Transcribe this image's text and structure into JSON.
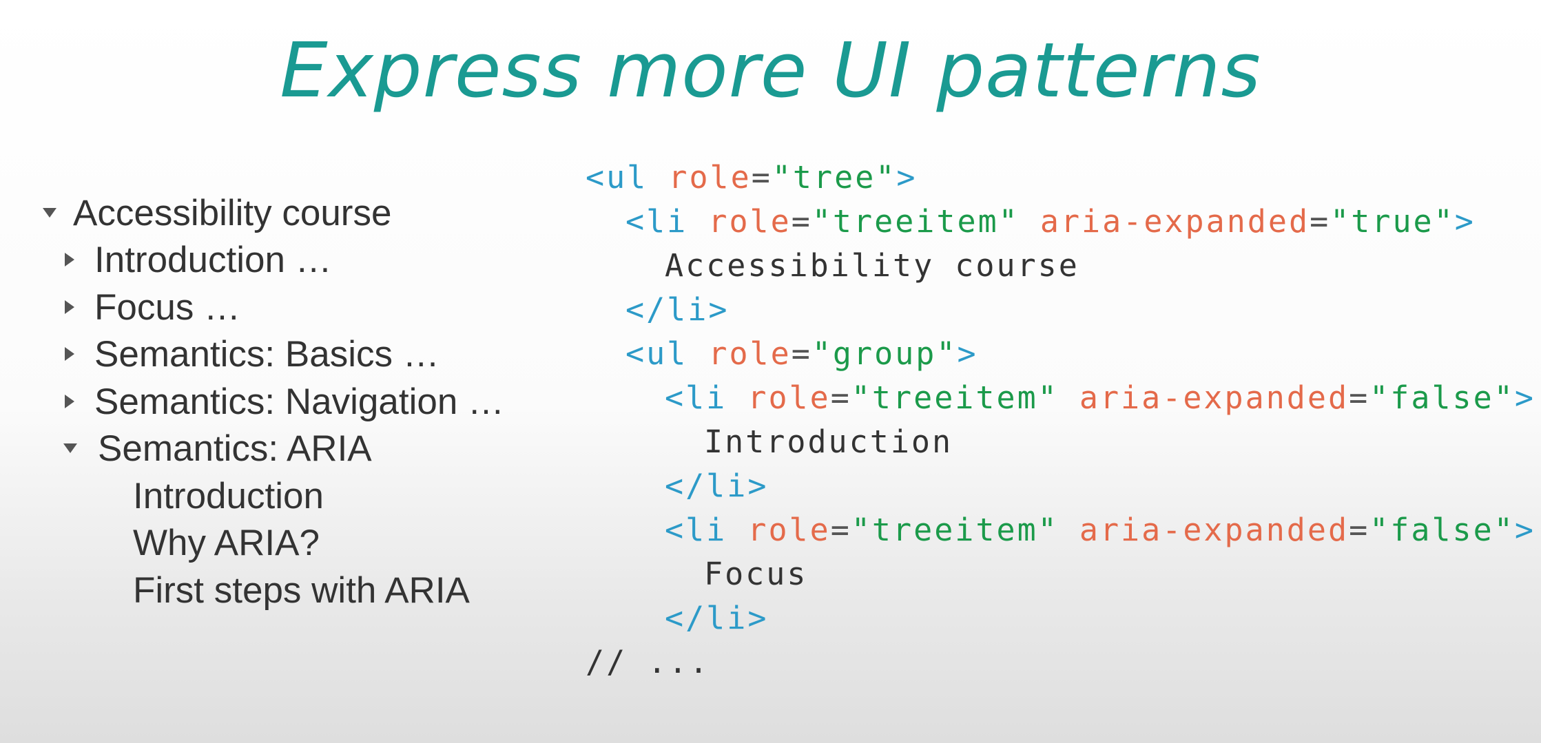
{
  "slide": {
    "title": "Express more UI patterns"
  },
  "tree": {
    "items": [
      {
        "label": "Accessibility course",
        "toggle": "expanded",
        "level": 0
      },
      {
        "label": "Introduction …",
        "toggle": "collapsed",
        "level": 1
      },
      {
        "label": "Focus …",
        "toggle": "collapsed",
        "level": 1
      },
      {
        "label": "Semantics: Basics …",
        "toggle": "collapsed",
        "level": 1
      },
      {
        "label": "Semantics: Navigation …",
        "toggle": "collapsed",
        "level": 1
      },
      {
        "label": "Semantics: ARIA",
        "toggle": "expanded",
        "level": 1
      },
      {
        "label": "Introduction",
        "toggle": "none",
        "level": 2
      },
      {
        "label": "Why ARIA?",
        "toggle": "none",
        "level": 2
      },
      {
        "label": "First steps with ARIA",
        "toggle": "none",
        "level": 2
      }
    ]
  },
  "code": {
    "line1": {
      "open": "<ul",
      "attr": "role",
      "eq": "=",
      "value": "\"tree\"",
      "close": ">"
    },
    "line2": {
      "open": "<li",
      "attr1": "role",
      "eq1": "=",
      "value1": "\"treeitem\"",
      "attr2": "aria-expanded",
      "eq2": "=",
      "value2": "\"true\"",
      "close": ">"
    },
    "line3": {
      "text": "Accessibility course"
    },
    "line4": {
      "tag": "</li>"
    },
    "line5": {
      "open": "<ul",
      "attr": "role",
      "eq": "=",
      "value": "\"group\"",
      "close": ">"
    },
    "line6": {
      "open": "<li",
      "attr1": "role",
      "eq1": "=",
      "value1": "\"treeitem\"",
      "attr2": "aria-expanded",
      "eq2": "=",
      "value2": "\"false\"",
      "close": ">"
    },
    "line7": {
      "text": "Introduction"
    },
    "line8": {
      "tag": "</li>"
    },
    "line9": {
      "open": "<li",
      "attr1": "role",
      "eq1": "=",
      "value1": "\"treeitem\"",
      "attr2": "aria-expanded",
      "eq2": "=",
      "value2": "\"false\"",
      "close": ">"
    },
    "line10": {
      "text": "Focus"
    },
    "line11": {
      "tag": "</li>"
    },
    "line12": {
      "text": "// ..."
    }
  },
  "colors": {
    "title": "#1a9a92",
    "tag": "#2c9ac8",
    "attribute": "#e46a4a",
    "string": "#1b9a4a",
    "text": "#333333"
  }
}
